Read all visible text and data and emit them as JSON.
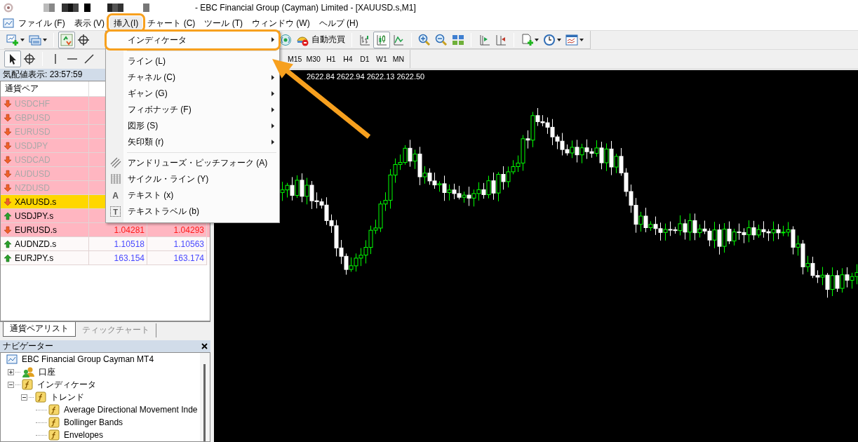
{
  "window": {
    "title": "- EBC Financial Group (Cayman) Limited - [XAUUSD.s,M1]"
  },
  "menu_bar": [
    {
      "label": "ファイル (F)",
      "selected": false
    },
    {
      "label": "表示 (V)",
      "selected": false
    },
    {
      "label": "挿入(I)",
      "selected": true
    },
    {
      "label": "チャート (C)",
      "selected": false
    },
    {
      "label": "ツール (T)",
      "selected": false
    },
    {
      "label": "ウィンドウ (W)",
      "selected": false
    },
    {
      "label": "ヘルプ (H)",
      "selected": false
    }
  ],
  "toolbar": {
    "view_buttons": [
      {
        "selected": true
      },
      {
        "selected": false
      }
    ],
    "auto_trading": "自動売買",
    "chart_types": [
      {
        "selected": false
      },
      {
        "selected": true
      },
      {
        "selected": false
      }
    ]
  },
  "drawing_tools": [
    {
      "selected": true
    },
    {
      "selected": false
    },
    {
      "selected": false
    },
    {
      "selected": false
    },
    {
      "selected": false
    }
  ],
  "timeframes": [
    "M15",
    "M30",
    "H1",
    "H4",
    "D1",
    "W1",
    "MN"
  ],
  "market_watch": {
    "title": "気配値表示: 23:57:59",
    "columns": [
      "通貨ペア"
    ],
    "rows": [
      {
        "symbol": "USDCHF",
        "kind": "down",
        "highlighted": true,
        "disabled": true,
        "selected": false
      },
      {
        "symbol": "GBPUSD",
        "kind": "down",
        "highlighted": true,
        "disabled": true,
        "selected": false
      },
      {
        "symbol": "EURUSD",
        "kind": "down",
        "highlighted": true,
        "disabled": true,
        "selected": false
      },
      {
        "symbol": "USDJPY",
        "kind": "down",
        "highlighted": true,
        "disabled": true,
        "selected": false
      },
      {
        "symbol": "USDCAD",
        "kind": "down",
        "highlighted": true,
        "disabled": true,
        "selected": false
      },
      {
        "symbol": "AUDUSD",
        "kind": "down",
        "highlighted": true,
        "disabled": true,
        "selected": false
      },
      {
        "symbol": "NZDUSD",
        "kind": "down",
        "highlighted": true,
        "disabled": true,
        "selected": false
      },
      {
        "symbol": "XAUUSD.s",
        "kind": "down",
        "disabled": false,
        "selected": true
      },
      {
        "symbol": "USDJPY.s",
        "kind": "up",
        "highlighted": true,
        "disabled": false,
        "selected": false
      },
      {
        "symbol": "EURUSD.s",
        "kind": "down",
        "highlighted": true,
        "disabled": false,
        "selected": false,
        "bid": "1.04281",
        "ask": "1.04293"
      },
      {
        "symbol": "AUDNZD.s",
        "kind": "up",
        "highlighted": false,
        "disabled": false,
        "selected": false,
        "bid": "1.10518",
        "ask": "1.10563"
      },
      {
        "symbol": "EURJPY.s",
        "kind": "up",
        "highlighted": false,
        "disabled": false,
        "selected": false,
        "bid": "163.154",
        "ask": "163.174"
      }
    ]
  },
  "watch_tabs": [
    {
      "label": "通貨ペアリスト",
      "selected": true
    },
    {
      "label": "ティックチャート",
      "selected": false
    }
  ],
  "navigator": {
    "title": "ナビゲーター",
    "tree": [
      {
        "label": "EBC Financial Group Cayman MT4",
        "kind": "terminal",
        "children": [
          {
            "label": "口座",
            "kind": "accounts",
            "expanded": false
          },
          {
            "label": "インディケータ",
            "kind": "group",
            "expanded": true,
            "children": [
              {
                "label": "トレンド",
                "kind": "group",
                "expanded": true,
                "children": [
                  {
                    "label": "Average Directional Movement Inde",
                    "kind": "indicator"
                  },
                  {
                    "label": "Bollinger Bands",
                    "kind": "indicator"
                  },
                  {
                    "label": "Envelopes",
                    "kind": "indicator"
                  }
                ]
              }
            ]
          }
        ]
      }
    ]
  },
  "insert_menu": [
    {
      "kind": "item",
      "label": "インディケータ",
      "submenu": true,
      "selected": true
    },
    {
      "kind": "separator"
    },
    {
      "kind": "item",
      "label": "ライン (L)",
      "submenu": false,
      "selected": false
    },
    {
      "kind": "item",
      "label": "チャネル (C)",
      "submenu": true,
      "selected": false
    },
    {
      "kind": "item",
      "label": "ギャン (G)",
      "submenu": true,
      "selected": false
    },
    {
      "kind": "item",
      "label": "フィボナッチ (F)",
      "submenu": true,
      "selected": false
    },
    {
      "kind": "item",
      "label": "図形 (S)",
      "submenu": true,
      "selected": false
    },
    {
      "kind": "item",
      "label": "矢印類 (r)",
      "submenu": true,
      "selected": false
    },
    {
      "kind": "separator"
    },
    {
      "kind": "pitchfork",
      "label": "アンドリューズ・ピッチフォーク (A)",
      "submenu": false,
      "selected": false
    },
    {
      "kind": "cycle_lines",
      "label": "サイクル・ライン (Y)",
      "submenu": false,
      "selected": false
    },
    {
      "kind": "text",
      "icon_char": "A",
      "label": "テキスト (x)",
      "submenu": false,
      "selected": false
    },
    {
      "kind": "text_label",
      "icon_char": "T",
      "label": "テキストラベル (b)",
      "submenu": false,
      "selected": false
    }
  ],
  "chart": {
    "ohlc": "2622.84 2622.94 2622.13 2622.50"
  }
}
